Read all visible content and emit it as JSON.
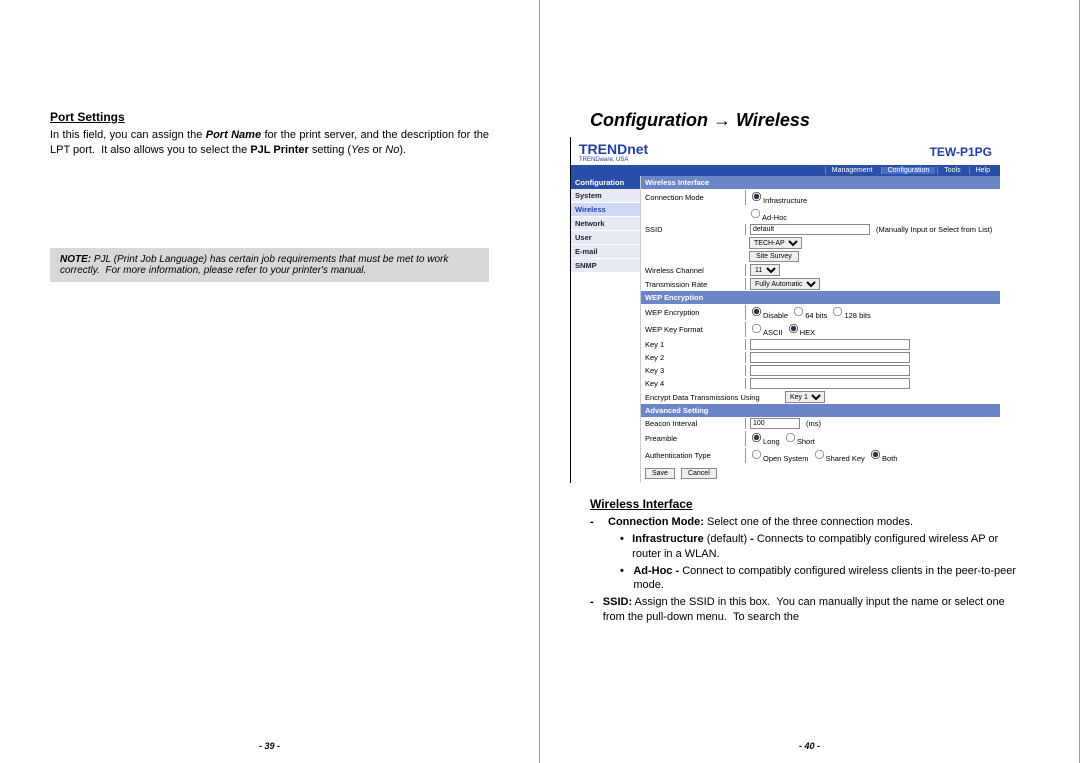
{
  "left": {
    "heading": "Port Settings",
    "para_html": "In this field, you can assign the <b><i>Port Name</i></b> for the print server, and the description for the LPT port.&nbsp;&nbsp;It also allows you to select the <b>PJL Printer</b> setting (<i>Yes</i> or <i>No</i>).",
    "note_html": "<b>NOTE:</b> PJL (Print Job Language) has certain job requirements that must be met to work correctly.&nbsp;&nbsp;For more information, please refer to your printer's manual.",
    "page_num": "- 39 -"
  },
  "right": {
    "heading": "Configuration → Wireless",
    "iface": {
      "logo": "TRENDnet",
      "logo_sub": "TRENDware, USA",
      "model": "TEW-P1PG",
      "nav": [
        "Management",
        "Configuration",
        "Tools",
        "Help"
      ],
      "side_hdr": "Configuration",
      "side": [
        "System",
        "Wireless",
        "Network",
        "User",
        "E-mail",
        "SNMP"
      ],
      "sec_wi": "Wireless Interface",
      "conn_mode": "Connection Mode",
      "conn_opt1": "Infrastructure",
      "conn_opt2": "Ad-Hoc",
      "ssid_lbl": "SSID",
      "ssid_val": "default",
      "ssid_hint": "(Manually Input or Select from List)",
      "ssid_sel": "TECH-AP",
      "survey_btn": "Site Survey",
      "chan_lbl": "Wireless Channel",
      "chan_val": "11",
      "rate_lbl": "Transmission Rate",
      "rate_val": "Fully Automatic",
      "sec_wep": "WEP Encryption",
      "wep_lbl": "WEP Encryption",
      "wep_a": "Disable",
      "wep_b": "64 bits",
      "wep_c": "128 bits",
      "kf_lbl": "WEP Key Format",
      "kf_a": "ASCII",
      "kf_b": "HEX",
      "k1": "Key 1",
      "k2": "Key 2",
      "k3": "Key 3",
      "k4": "Key 4",
      "edt": "Encrypt Data Transmissions Using",
      "edt_v": "Key 1",
      "sec_adv": "Advanced Setting",
      "bi_lbl": "Beacon Interval",
      "bi_v": "100",
      "bi_u": "(ms)",
      "pr_lbl": "Preamble",
      "pr_a": "Long",
      "pr_b": "Short",
      "at_lbl": "Authentication Type",
      "at_a": "Open System",
      "at_b": "Shared Key",
      "at_c": "Both",
      "save": "Save",
      "cancel": "Cancel"
    },
    "sub": "Wireless Interface",
    "li1_html": "<b>Connection Mode:</b> Select one of the three connection modes.",
    "li1a_html": "<b>Infrastructure</b> (default) <b>-</b> Connects to compatibly configured wireless AP or router in a WLAN.",
    "li1b_html": "<b>Ad-Hoc -</b> Connect to compatibly configured wireless clients in the peer-to-peer mode.",
    "li2_html": "<b>SSID:</b> Assign the SSID in this box.&nbsp;&nbsp;You can manually input the name or select one from the pull-down menu.&nbsp;&nbsp;To search the",
    "page_num": "- 40 -"
  }
}
